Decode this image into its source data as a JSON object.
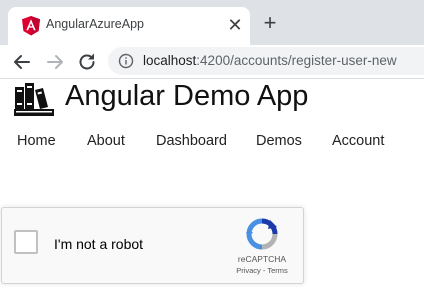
{
  "browser": {
    "tab": {
      "title": "AngularAzureApp",
      "close_glyph": "✕"
    },
    "new_tab_glyph": "+",
    "address": {
      "host": "localhost",
      "path": ":4200/accounts/register-user-new"
    },
    "icons": {
      "favicon": "angular-logo-icon",
      "back": "arrow-left-icon",
      "forward": "arrow-right-icon",
      "reload": "reload-icon",
      "site_info": "info-icon"
    }
  },
  "app": {
    "title": "Angular Demo App",
    "logo_icon": "books-icon",
    "nav": [
      {
        "label": "Home"
      },
      {
        "label": "About"
      },
      {
        "label": "Dashboard"
      },
      {
        "label": "Demos"
      },
      {
        "label": "Account"
      }
    ]
  },
  "recaptcha": {
    "label": "I'm not a robot",
    "brand": "reCAPTCHA",
    "privacy": "Privacy",
    "separator": " - ",
    "terms": "Terms",
    "checked": false
  },
  "colors": {
    "angular_red": "#dd0031",
    "tab_strip": "#dee1e6",
    "omnibox": "#f1f3f4",
    "recaptcha_blue": "#4a90e2",
    "recaptcha_gray": "#b3b3b3"
  }
}
